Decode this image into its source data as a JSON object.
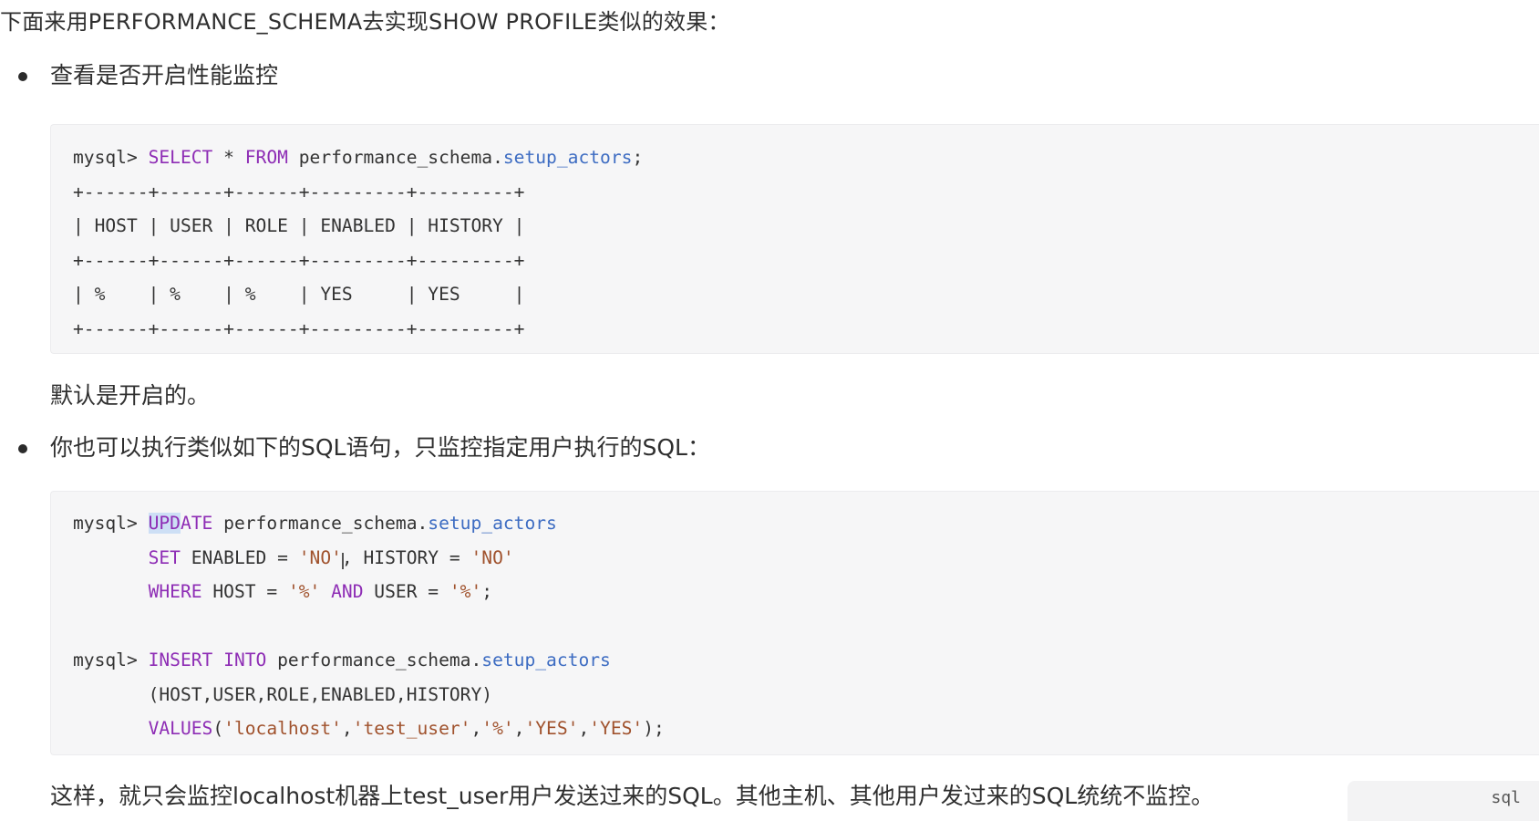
{
  "intro": "下面来用PERFORMANCE_SCHEMA去实现SHOW PROFILE类似的效果：",
  "bullet1": "查看是否开启性能监控",
  "code1": {
    "prompt": "mysql> ",
    "select_kw": "SELECT",
    "star": " * ",
    "from_kw": "FROM",
    "schema": " performance_schema.",
    "table": "setup_actors",
    "semicolon": ";",
    "border": "+------+------+------+---------+---------+",
    "header_row": "| HOST | USER | ROLE | ENABLED | HISTORY |",
    "data_row": "| %    | %    | %    | YES     | YES     |"
  },
  "default_note": "默认是开启的。",
  "bullet2": "你也可以执行类似如下的SQL语句，只监控指定用户执行的SQL：",
  "code2": {
    "prompt": "mysql> ",
    "update_kw_a": "UPD",
    "update_kw_b": "ATE",
    "schema": " performance_schema.",
    "table": "setup_actors",
    "set_kw": "SET",
    "set_rest_1": " ENABLED = ",
    "no_1": "'NO'",
    "comma_1": ",",
    "set_rest_2": " HISTORY = ",
    "no_2": "'NO'",
    "where_kw": "WHERE",
    "where_rest_1": " HOST = ",
    "pct_1": "'%'",
    "and_kw": " AND",
    "where_rest_2": " USER = ",
    "pct_2": "'%'",
    "semicolon": ";",
    "insert_kw": "INSERT",
    "into_kw": " INTO",
    "schema2": " performance_schema.",
    "table2": "setup_actors",
    "columns": "(HOST,USER,ROLE,ENABLED,HISTORY)",
    "values_kw": "VALUES",
    "open_paren": "(",
    "v1": "'localhost'",
    "v2": "'test_user'",
    "v3": "'%'",
    "v4": "'YES'",
    "v5": "'YES'",
    "sep": ",",
    "close": ");",
    "language": "sql"
  },
  "footer_note": "这样，就只会监控localhost机器上test_user用户发送过来的SQL。其他主机、其他用户发过来的SQL统统不监控。"
}
